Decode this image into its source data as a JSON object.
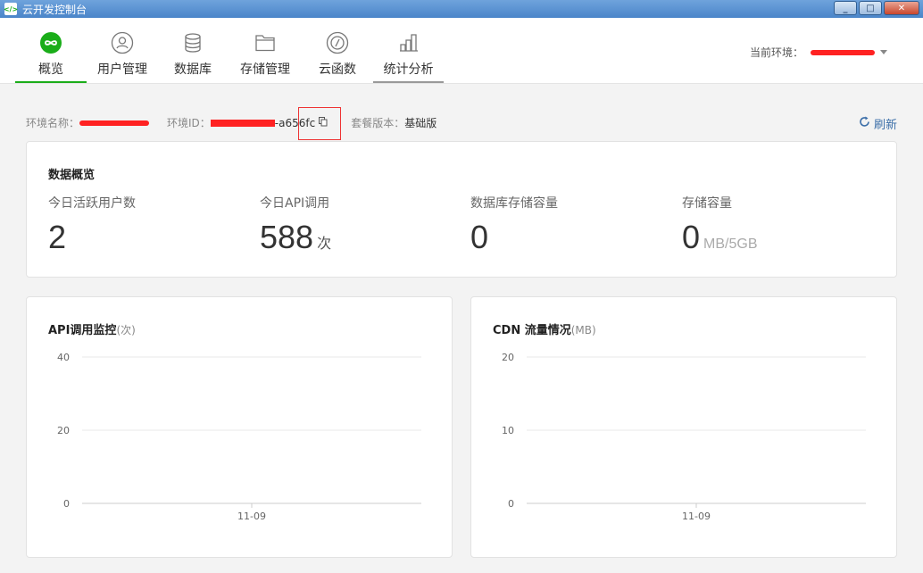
{
  "window": {
    "title": "云开发控制台",
    "buttons": [
      "_",
      "□",
      "✕"
    ]
  },
  "nav": {
    "items": [
      {
        "label": "概览",
        "icon": "infinity-icon"
      },
      {
        "label": "用户管理",
        "icon": "user-icon"
      },
      {
        "label": "数据库",
        "icon": "database-icon"
      },
      {
        "label": "存储管理",
        "icon": "folder-icon"
      },
      {
        "label": "云函数",
        "icon": "function-icon"
      },
      {
        "label": "统计分析",
        "icon": "bar-chart-icon"
      }
    ],
    "env_label": "当前环境："
  },
  "info": {
    "env_name_label": "环境名称：",
    "env_id_label": "环境ID：",
    "env_id_suffix": "-a656fc",
    "plan_label": "套餐版本：",
    "plan_value": "基础版",
    "refresh_label": "刷新"
  },
  "overview": {
    "title": "数据概览",
    "stats": [
      {
        "name": "今日活跃用户数",
        "value": "2",
        "unit": ""
      },
      {
        "name": "今日API调用",
        "value": "588",
        "unit": "次"
      },
      {
        "name": "数据库存储容量",
        "value": "0",
        "unit": ""
      },
      {
        "name": "存储容量",
        "value": "0",
        "unit": "MB/5GB"
      }
    ]
  },
  "charts": [
    {
      "title": "API调用监控",
      "unit": "(次)"
    },
    {
      "title": "CDN 流量情况",
      "unit": "(MB)"
    }
  ],
  "chart_data": [
    {
      "type": "line",
      "title": "API调用监控",
      "ylabel": "次",
      "x": [
        "11-09"
      ],
      "yticks": [
        0,
        20,
        40
      ],
      "ylim": [
        0,
        40
      ],
      "series": []
    },
    {
      "type": "line",
      "title": "CDN 流量情况",
      "ylabel": "MB",
      "x": [
        "11-09"
      ],
      "yticks": [
        0,
        10,
        20
      ],
      "ylim": [
        0,
        20
      ],
      "series": []
    }
  ],
  "colors": {
    "accent": "#1aad19",
    "redaction": "#ff2222",
    "link": "#3b6ea8"
  }
}
